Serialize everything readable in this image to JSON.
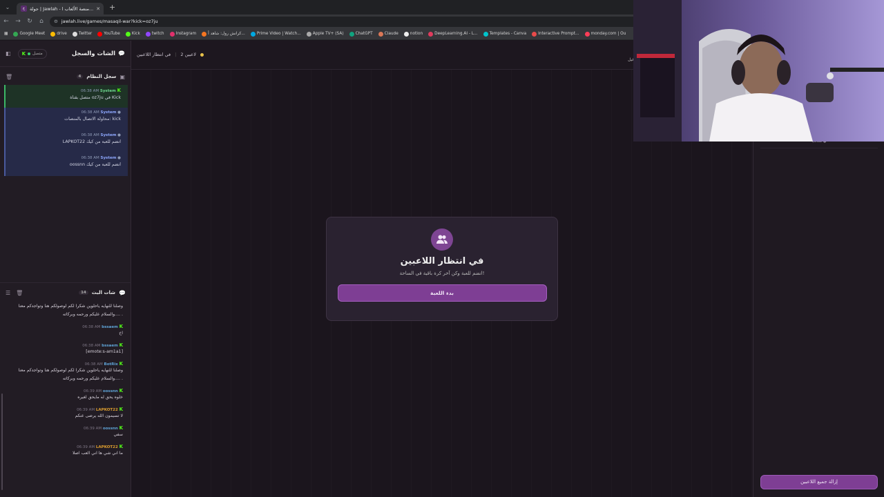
{
  "browser": {
    "tab_title": "جولة | Jawlah - منصة الألعاب ا...",
    "url": "jawlah.live/games/masaqil-war?kick=oz7ju",
    "new_tab_label": "+",
    "bookmarks": [
      "Google Meet",
      "drive",
      "Twitter",
      "YouTube",
      "Kick",
      "twitch",
      "Instagram",
      "كرانش رول: شاهد أ...",
      "Prime Video | Watch...",
      "Apple TV+ (SA)",
      "ChatGPT",
      "Claude",
      "notion",
      "DeepLearning.AI - L...",
      "Templates - Canva",
      "Interactive Prompt...",
      "monday.com | Ou"
    ]
  },
  "sidebar": {
    "title": "الشات والسجل",
    "connection": "متصل",
    "system_log": {
      "title": "سجل النظام",
      "count": "4",
      "items": [
        {
          "sender": "System",
          "time": "06:38 AM",
          "text": "متصل بقناة oz7ju في Kick"
        },
        {
          "sender": "System",
          "time": "06:38 AM",
          "text": "محاولة الاتصال بالمنصات: kick"
        },
        {
          "sender": "System",
          "time": "06:38 AM",
          "text": "LAPKOT22 انضم للعبة من كيك"
        },
        {
          "sender": "System",
          "time": "06:38 AM",
          "text": "oossnn انضم للعبة من كيك"
        }
      ]
    },
    "chat": {
      "title": "شات البث",
      "count": "14",
      "messages": [
        {
          "user": "",
          "time": "",
          "text": "وصلنا للنهايه ياحلوين شكرا لكم لوصولكم هنا وتواجدكم معنا ....والسلام عليكم ورحمه وبركاته ."
        },
        {
          "user": "bssaem",
          "time": "06:38 AM",
          "text": "اخ"
        },
        {
          "user": "bssaem",
          "time": "06:38 AM",
          "text": "[emote:s-am1a1]"
        },
        {
          "user": "BotRix",
          "time": "06:38 AM",
          "text": "وصلنا للنهايه ياحلوين شكرا لكم لوصولكم هنا وتواجدكم معنا ....والسلام عليكم ورحمه وبركاته ."
        },
        {
          "user": "oossnn",
          "time": "06:39 AM",
          "text": "خلوه يحق له مايحق لغيره"
        },
        {
          "user": "LAPKOT22",
          "time": "06:39 AM",
          "text": "لا تسيمون الله يرضى عنكم"
        },
        {
          "user": "oossnn",
          "time": "06:39 AM",
          "text": "سفي"
        },
        {
          "user": "LAPKOT22",
          "time": "06:39 AM",
          "text": "ما اني شي ها اني العب اصلا"
        }
      ]
    }
  },
  "topbar": {
    "players": "2 لاعبين",
    "state": "في انتظار اللاعبين",
    "right_text": "اقيل"
  },
  "card": {
    "title": "في انتظار اللاعبين",
    "subtitle": "انضم للعبة وكن آخر كرة باقية في الساحة!",
    "start_button": "بدء اللعبة"
  },
  "right_panel": {
    "item_text": "مكاتب ●",
    "remove_button": "إزالة جميع اللاعبين"
  },
  "colors": {
    "accent": "#7e3e94",
    "kick": "#53fc18",
    "system_blue": "#8fa9ff"
  }
}
